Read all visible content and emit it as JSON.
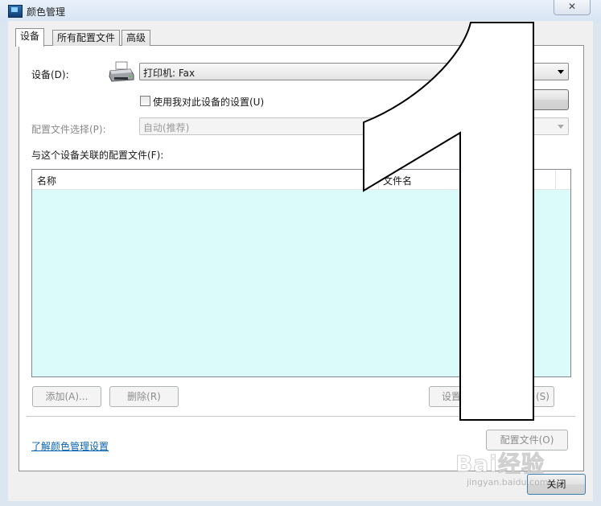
{
  "window": {
    "title": "颜色管理",
    "close_label": "✕"
  },
  "tabs": [
    {
      "label": "设备",
      "active": true
    },
    {
      "label": "所有配置文件",
      "active": false
    },
    {
      "label": "高级",
      "active": false
    }
  ],
  "device": {
    "label": "设备(D):",
    "selected": "打印机: Fax",
    "use_my_settings_label": "使用我对此设备的设置(U)",
    "use_my_settings_checked": false
  },
  "profile_selection": {
    "label": "配置文件选择(P):",
    "selected": "自动(推荐)"
  },
  "associated": {
    "label": "与这个设备关联的配置文件(F):",
    "columns": [
      "名称",
      "文件名"
    ],
    "rows": []
  },
  "buttons": {
    "add": "添加(A)...",
    "remove": "删除(R)",
    "set_default": "设置",
    "set_default_tail": "(S)",
    "profiles": "配置文件(O)",
    "close": "关闭"
  },
  "link": "了解颜色管理设置",
  "overlay": {
    "glyph": "1"
  },
  "watermark": {
    "logo": "Bai经验",
    "url": "jingyan.baidu.com"
  },
  "colors": {
    "list_background": "#dafbfa",
    "link": "#0b63b5"
  }
}
